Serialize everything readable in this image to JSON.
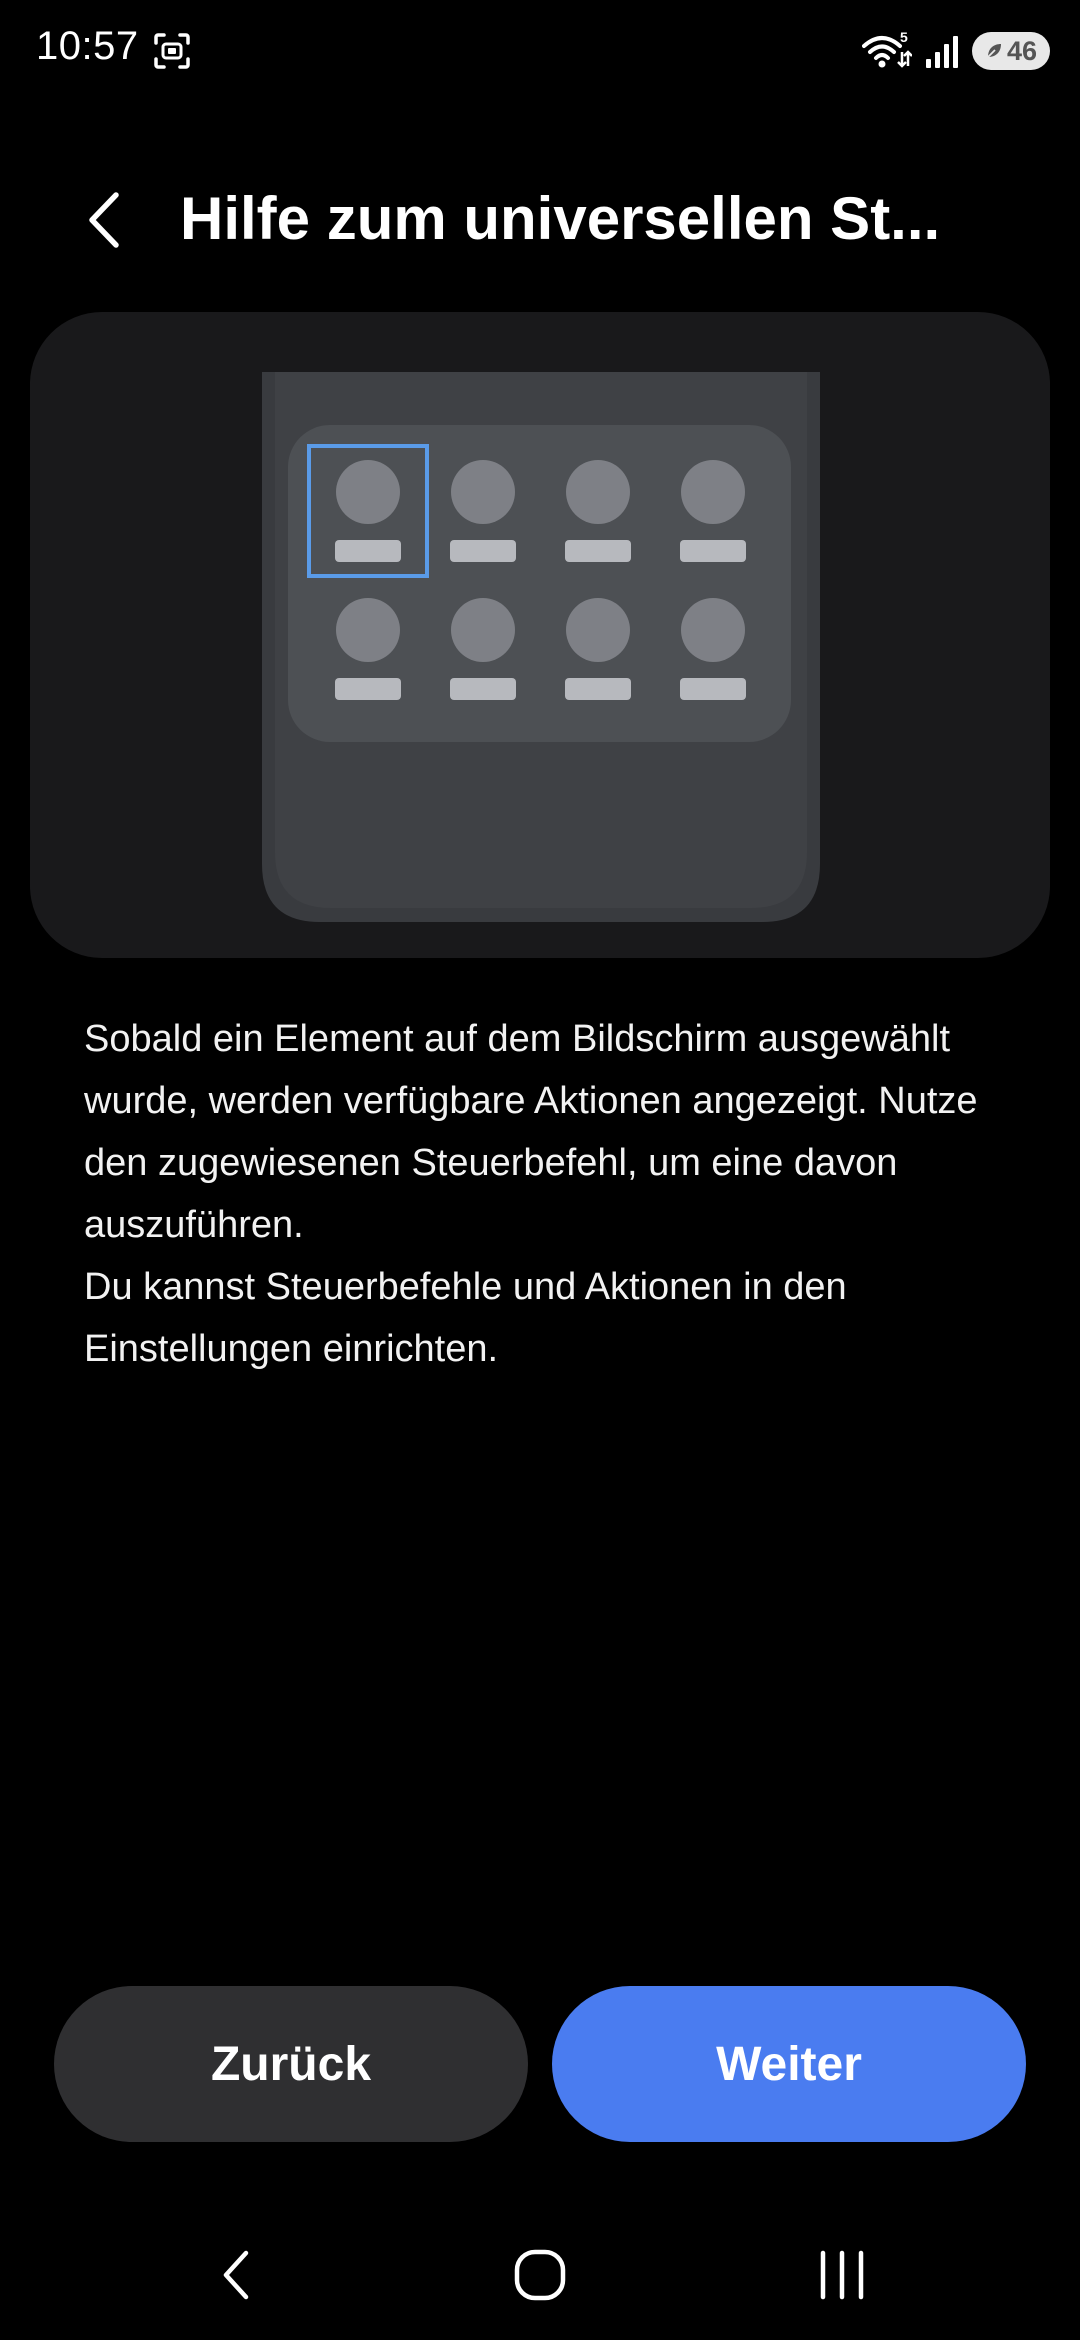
{
  "status_bar": {
    "time": "10:57",
    "battery_level": "46",
    "network_badge": "5",
    "icons": [
      "screenshot-icon",
      "wifi-icon",
      "signal-icon",
      "battery-saver-icon"
    ]
  },
  "header": {
    "back_icon": "chevron-left-icon",
    "title": "Hilfe zum universellen St..."
  },
  "illustration": {
    "grid_rows": 2,
    "grid_columns": 4,
    "selected_item_index": 0,
    "colors": {
      "card": "#19191b",
      "phone": "#393b3f",
      "panel": "#4d5054",
      "item": "#7e8086",
      "label": "#b7b9be",
      "selection": "#5a9be8"
    }
  },
  "description": {
    "paragraph_1": "Sobald ein Element auf dem Bildschirm ausgewählt wurde, werden verfügbare Aktionen angezeigt. Nutze den zugewiesenen Steuerbefehl, um eine davon auszuführen.",
    "paragraph_2": "Du kannst Steuerbefehle und Aktionen in den Einstellungen einrichten."
  },
  "buttons": {
    "back_label": "Zurück",
    "next_label": "Weiter",
    "next_color": "#4a7cf0",
    "back_color": "#2f2f31"
  },
  "nav_bar": {
    "items": [
      "nav-back-icon",
      "nav-home-icon",
      "nav-recents-icon"
    ]
  }
}
